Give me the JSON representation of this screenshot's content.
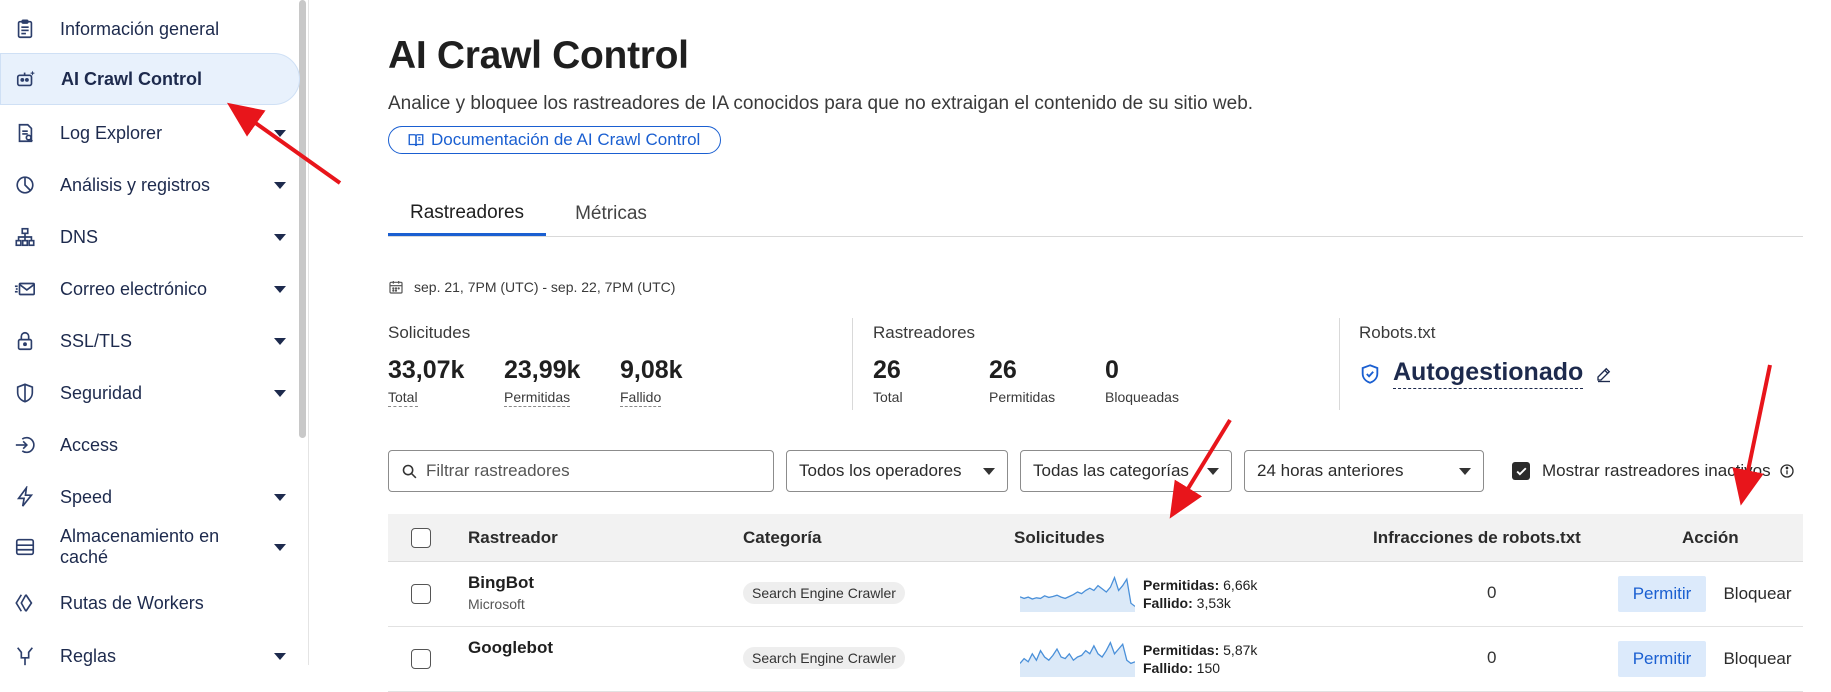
{
  "sidebar": {
    "items": [
      {
        "label": "Información general",
        "icon": "clipboard-icon",
        "caret": false,
        "active": false
      },
      {
        "label": "AI Crawl Control",
        "icon": "robot-icon",
        "caret": false,
        "active": true
      },
      {
        "label": "Log Explorer",
        "icon": "log-explorer-icon",
        "caret": true,
        "active": false
      },
      {
        "label": "Análisis y registros",
        "icon": "pie-chart-icon",
        "caret": true,
        "active": false
      },
      {
        "label": "DNS",
        "icon": "network-icon",
        "caret": true,
        "active": false
      },
      {
        "label": "Correo electrónico",
        "icon": "mail-icon",
        "caret": true,
        "active": false
      },
      {
        "label": "SSL/TLS",
        "icon": "lock-icon",
        "caret": true,
        "active": false
      },
      {
        "label": "Seguridad",
        "icon": "shield-icon",
        "caret": true,
        "active": false
      },
      {
        "label": "Access",
        "icon": "login-icon",
        "caret": false,
        "active": false
      },
      {
        "label": "Speed",
        "icon": "lightning-icon",
        "caret": true,
        "active": false
      },
      {
        "label": "Almacenamiento en caché",
        "icon": "storage-icon",
        "caret": true,
        "active": false
      },
      {
        "label": "Rutas de Workers",
        "icon": "workers-icon",
        "caret": false,
        "active": false
      },
      {
        "label": "Reglas",
        "icon": "rules-icon",
        "caret": true,
        "active": false
      }
    ]
  },
  "header": {
    "title": "AI Crawl Control",
    "subtitle": "Analice y bloquee los rastreadores de IA conocidos para que no extraigan el contenido de su sitio web.",
    "doc_link": "Documentación de AI Crawl Control"
  },
  "tabs": [
    {
      "label": "Rastreadores",
      "active": true
    },
    {
      "label": "Métricas",
      "active": false
    }
  ],
  "date_range": "sep. 21, 7PM (UTC) - sep. 22, 7PM (UTC)",
  "stats": {
    "requests": {
      "title": "Solicitudes",
      "items": [
        {
          "value": "33,07k",
          "caption": "Total"
        },
        {
          "value": "23,99k",
          "caption": "Permitidas"
        },
        {
          "value": "9,08k",
          "caption": "Fallido"
        }
      ]
    },
    "crawlers": {
      "title": "Rastreadores",
      "items": [
        {
          "value": "26",
          "caption": "Total"
        },
        {
          "value": "26",
          "caption": "Permitidas"
        },
        {
          "value": "0",
          "caption": "Bloqueadas"
        }
      ]
    },
    "robots": {
      "title": "Robots.txt",
      "value": "Autogestionado"
    }
  },
  "filters": {
    "search_placeholder": "Filtrar rastreadores",
    "operators": "Todos los operadores",
    "categories": "Todas las categorías",
    "time": "24 horas anteriores",
    "show_inactive": "Mostrar rastreadores inactivos",
    "show_inactive_checked": true
  },
  "table": {
    "headers": {
      "crawler": "Rastreador",
      "category": "Categoría",
      "requests": "Solicitudes",
      "robots_violations": "Infracciones de robots.txt",
      "action": "Acción"
    },
    "rows": [
      {
        "name": "BingBot",
        "operator": "Microsoft",
        "category": "Search Engine Crawler",
        "allowed_label": "Permitidas:",
        "allowed": "6,66k",
        "failed_label": "Fallido:",
        "failed": "3,53k",
        "violations": "0",
        "allow": "Permitir",
        "block": "Bloquear",
        "spark": [
          0.35,
          0.3,
          0.34,
          0.28,
          0.32,
          0.3,
          0.38,
          0.33,
          0.36,
          0.4,
          0.34,
          0.3,
          0.36,
          0.42,
          0.5,
          0.45,
          0.55,
          0.62,
          0.55,
          0.7,
          0.6,
          0.5,
          0.65,
          0.95,
          0.55,
          0.7,
          0.9,
          0.15,
          0.05
        ]
      },
      {
        "name": "Googlebot",
        "operator": "",
        "category": "Search Engine Crawler",
        "allowed_label": "Permitidas:",
        "allowed": "5,87k",
        "failed_label": "Fallido:",
        "failed": "150",
        "violations": "0",
        "allow": "Permitir",
        "block": "Bloquear",
        "spark": [
          0.3,
          0.45,
          0.35,
          0.6,
          0.4,
          0.7,
          0.5,
          0.4,
          0.55,
          0.75,
          0.5,
          0.45,
          0.6,
          0.4,
          0.5,
          0.55,
          0.7,
          0.6,
          0.85,
          0.6,
          0.5,
          0.7,
          0.95,
          0.6,
          0.75,
          0.9,
          0.4,
          0.3,
          0.35
        ]
      }
    ]
  },
  "colors": {
    "accent": "#1a5fd1",
    "sidebar_active_bg": "#e8f1fc",
    "annotation_arrow": "#e8151b",
    "spark_line": "#4a90d9"
  }
}
